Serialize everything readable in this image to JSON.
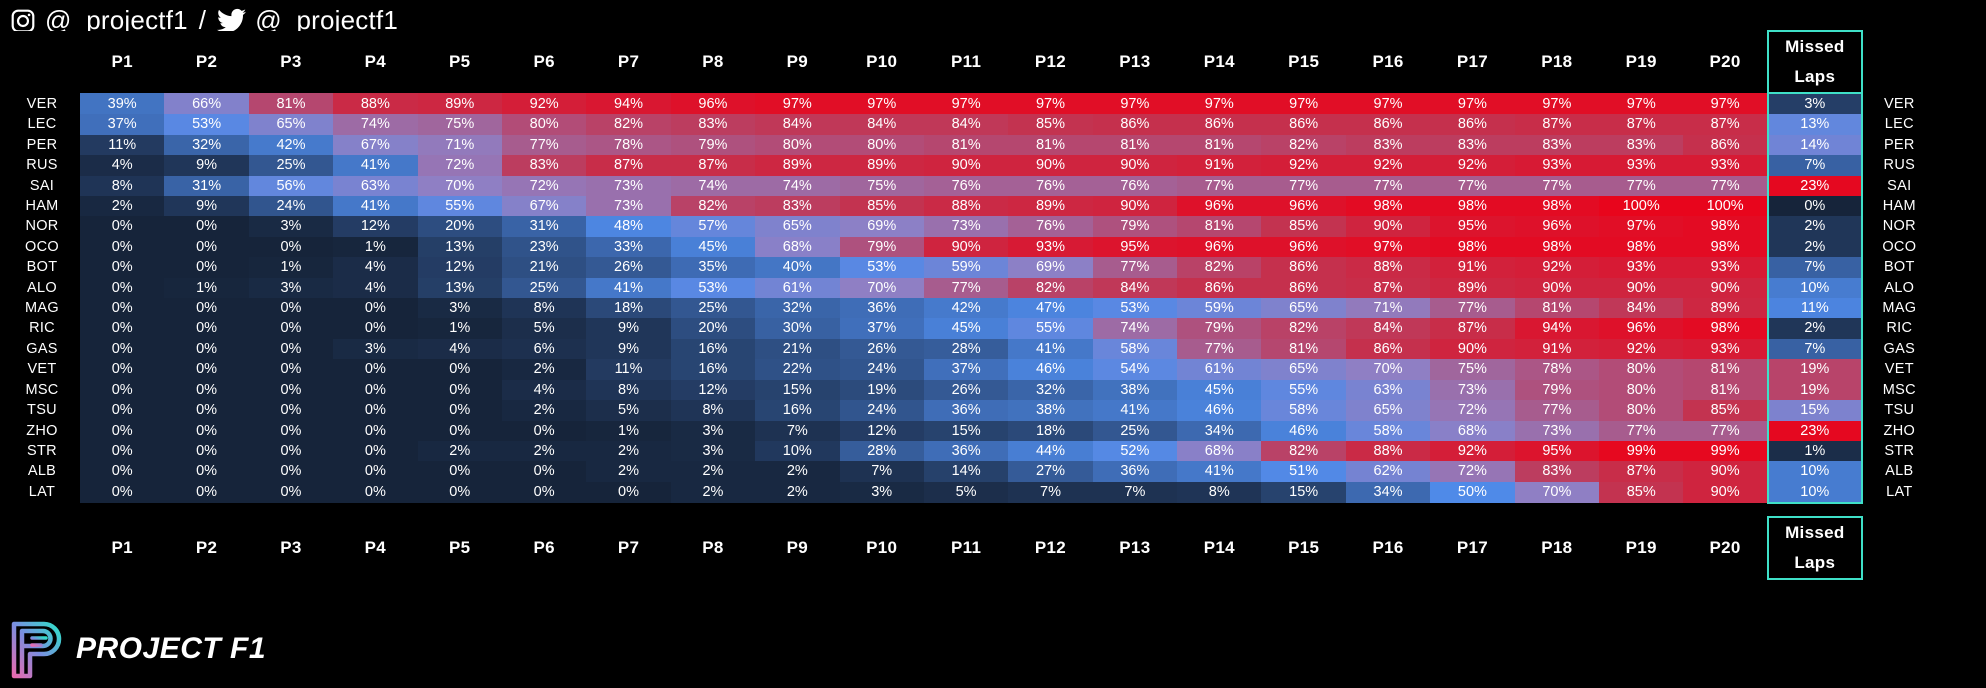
{
  "header": {
    "instagram_handle": "@_projectf1",
    "separator": "/",
    "twitter_handle": "@_projectf1",
    "instagram_icon": "instagram-icon",
    "twitter_icon": "twitter-icon"
  },
  "footer": {
    "brand": "PROJECT F1",
    "logo_icon": "project-f1-logo"
  },
  "theme": {
    "background": "#000000",
    "accent_teal": "#3fe0c8",
    "low_color": "#16243a",
    "mid_color": "#6c8fd6",
    "high_color": "#e8051c",
    "text": "#ffffff"
  },
  "chart_data": {
    "type": "heatmap",
    "title": "",
    "xlabel": "",
    "ylabel": "",
    "colorscale": {
      "min": 0,
      "max": 100,
      "unit": "%",
      "stops": [
        {
          "value": 0,
          "color": "#16243a"
        },
        {
          "value": 50,
          "color": "#4f8ae8"
        },
        {
          "value": 70,
          "color": "#8f7fc4"
        },
        {
          "value": 85,
          "color": "#c33350"
        },
        {
          "value": 100,
          "color": "#e8051c"
        }
      ]
    },
    "columns": [
      "P1",
      "P2",
      "P3",
      "P4",
      "P5",
      "P6",
      "P7",
      "P8",
      "P9",
      "P10",
      "P11",
      "P12",
      "P13",
      "P14",
      "P15",
      "P16",
      "P17",
      "P18",
      "P19",
      "P20"
    ],
    "extra_column": "Missed\nLaps",
    "extra_column_label_line1": "Missed",
    "extra_column_label_line2": "Laps",
    "rows": [
      "VER",
      "LEC",
      "PER",
      "RUS",
      "SAI",
      "HAM",
      "NOR",
      "OCO",
      "BOT",
      "ALO",
      "MAG",
      "RIC",
      "GAS",
      "VET",
      "MSC",
      "TSU",
      "ZHO",
      "STR",
      "ALB",
      "LAT"
    ],
    "values": [
      [
        39,
        66,
        81,
        88,
        89,
        92,
        94,
        96,
        97,
        97,
        97,
        97,
        97,
        97,
        97,
        97,
        97,
        97,
        97,
        97
      ],
      [
        37,
        53,
        65,
        74,
        75,
        80,
        82,
        83,
        84,
        84,
        84,
        85,
        86,
        86,
        86,
        86,
        86,
        87,
        87,
        87
      ],
      [
        11,
        32,
        42,
        67,
        71,
        77,
        78,
        79,
        80,
        80,
        81,
        81,
        81,
        81,
        82,
        83,
        83,
        83,
        83,
        86
      ],
      [
        4,
        9,
        25,
        41,
        72,
        83,
        87,
        87,
        89,
        89,
        90,
        90,
        90,
        91,
        92,
        92,
        92,
        93,
        93,
        93
      ],
      [
        8,
        31,
        56,
        63,
        70,
        72,
        73,
        74,
        74,
        75,
        76,
        76,
        76,
        77,
        77,
        77,
        77,
        77,
        77,
        77
      ],
      [
        2,
        9,
        24,
        41,
        55,
        67,
        73,
        82,
        83,
        85,
        88,
        89,
        90,
        96,
        96,
        98,
        98,
        98,
        100,
        100
      ],
      [
        0,
        0,
        3,
        12,
        20,
        31,
        48,
        57,
        65,
        69,
        73,
        76,
        79,
        81,
        85,
        90,
        95,
        96,
        97,
        98
      ],
      [
        0,
        0,
        0,
        1,
        13,
        23,
        33,
        45,
        68,
        79,
        90,
        93,
        95,
        96,
        96,
        97,
        98,
        98,
        98,
        98
      ],
      [
        0,
        0,
        1,
        4,
        12,
        21,
        26,
        35,
        40,
        53,
        59,
        69,
        77,
        82,
        86,
        88,
        91,
        92,
        93,
        93
      ],
      [
        0,
        1,
        3,
        4,
        13,
        25,
        41,
        53,
        61,
        70,
        77,
        82,
        84,
        86,
        86,
        87,
        89,
        90,
        90,
        90
      ],
      [
        0,
        0,
        0,
        0,
        3,
        8,
        18,
        25,
        32,
        36,
        42,
        47,
        53,
        59,
        65,
        71,
        77,
        81,
        84,
        89
      ],
      [
        0,
        0,
        0,
        0,
        1,
        5,
        9,
        20,
        30,
        37,
        45,
        55,
        74,
        79,
        82,
        84,
        87,
        94,
        96,
        98
      ],
      [
        0,
        0,
        0,
        3,
        4,
        6,
        9,
        16,
        21,
        26,
        28,
        41,
        58,
        77,
        81,
        86,
        90,
        91,
        92,
        93
      ],
      [
        0,
        0,
        0,
        0,
        0,
        2,
        11,
        16,
        22,
        24,
        37,
        46,
        54,
        61,
        65,
        70,
        75,
        78,
        80,
        81
      ],
      [
        0,
        0,
        0,
        0,
        0,
        4,
        8,
        12,
        15,
        19,
        26,
        32,
        38,
        45,
        55,
        63,
        73,
        79,
        80,
        81
      ],
      [
        0,
        0,
        0,
        0,
        0,
        2,
        5,
        8,
        16,
        24,
        36,
        38,
        41,
        46,
        58,
        65,
        72,
        77,
        80,
        85
      ],
      [
        0,
        0,
        0,
        0,
        0,
        0,
        1,
        3,
        7,
        12,
        15,
        18,
        25,
        34,
        46,
        58,
        68,
        73,
        77,
        77
      ],
      [
        0,
        0,
        0,
        0,
        2,
        2,
        2,
        3,
        10,
        28,
        36,
        44,
        52,
        68,
        82,
        88,
        92,
        95,
        99,
        99
      ],
      [
        0,
        0,
        0,
        0,
        0,
        0,
        2,
        2,
        2,
        7,
        14,
        27,
        36,
        41,
        51,
        62,
        72,
        83,
        87,
        90
      ],
      [
        0,
        0,
        0,
        0,
        0,
        0,
        0,
        2,
        2,
        3,
        5,
        7,
        7,
        8,
        15,
        34,
        50,
        70,
        85,
        90
      ]
    ],
    "missed_laps": [
      3,
      13,
      14,
      7,
      23,
      0,
      2,
      2,
      7,
      10,
      11,
      2,
      7,
      19,
      19,
      15,
      23,
      1,
      10,
      10
    ]
  }
}
